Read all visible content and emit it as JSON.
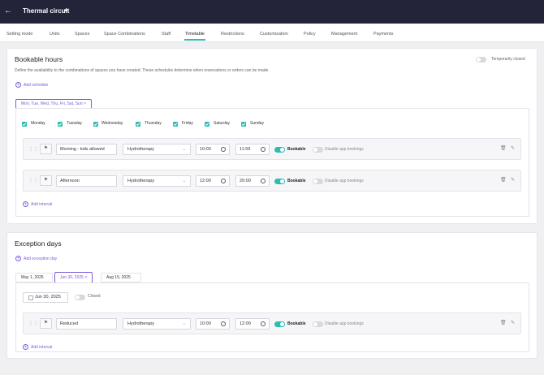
{
  "header": {
    "title": "Thermal circuit",
    "back_icon": "arrow-left-icon"
  },
  "nav": {
    "tabs": [
      "Setting mode",
      "Units",
      "Spaces",
      "Space Combinations",
      "Staff",
      "Timetable",
      "Restrictions",
      "Customization",
      "Policy",
      "Management",
      "Payments"
    ],
    "active": "Timetable"
  },
  "bookable": {
    "title": "Bookable hours",
    "temp_closed_label": "Temporarily closed",
    "description": "Define the availability to the combinations of spaces you have created. These schedules determine when reservations or orders can be made.",
    "add_schedule": "Add schedule",
    "schedule_chip": "Mon, Tue, Wed, Thu, Fri, Sat, Sun",
    "days": [
      "Monday",
      "Tuesday",
      "Wednesday",
      "Thursday",
      "Friday",
      "Saturday",
      "Sunday"
    ],
    "intervals": [
      {
        "name": "Morning - kids allowed",
        "service": "Hydrotherapy",
        "start": "10:00",
        "end": "11:59",
        "bookable_label": "Bookable",
        "disable_label": "Disable app bookings"
      },
      {
        "name": "Afternoon",
        "service": "Hydrotherapy",
        "start": "12:00",
        "end": "20:00",
        "bookable_label": "Bookable",
        "disable_label": "Disable app bookings"
      }
    ],
    "add_interval": "Add interval"
  },
  "exceptions": {
    "title": "Exception days",
    "add_exception": "Add exception day",
    "dates": [
      "May 1, 2025",
      "Jun 30, 2025",
      "Aug 15, 2025"
    ],
    "selected_date": "Jun 30, 2025",
    "date_field": "Jun 30, 2025",
    "closed_label": "Closed",
    "interval": {
      "name": "Reduced",
      "service": "Hydrotherapy",
      "start": "10:00",
      "end": "12:00",
      "bookable_label": "Bookable",
      "disable_label": "Disable app bookings"
    },
    "add_interval": "Add interval"
  },
  "colors": {
    "accent": "#2cbdaf",
    "link": "#7b5cd6",
    "header_bg": "#23233a"
  }
}
